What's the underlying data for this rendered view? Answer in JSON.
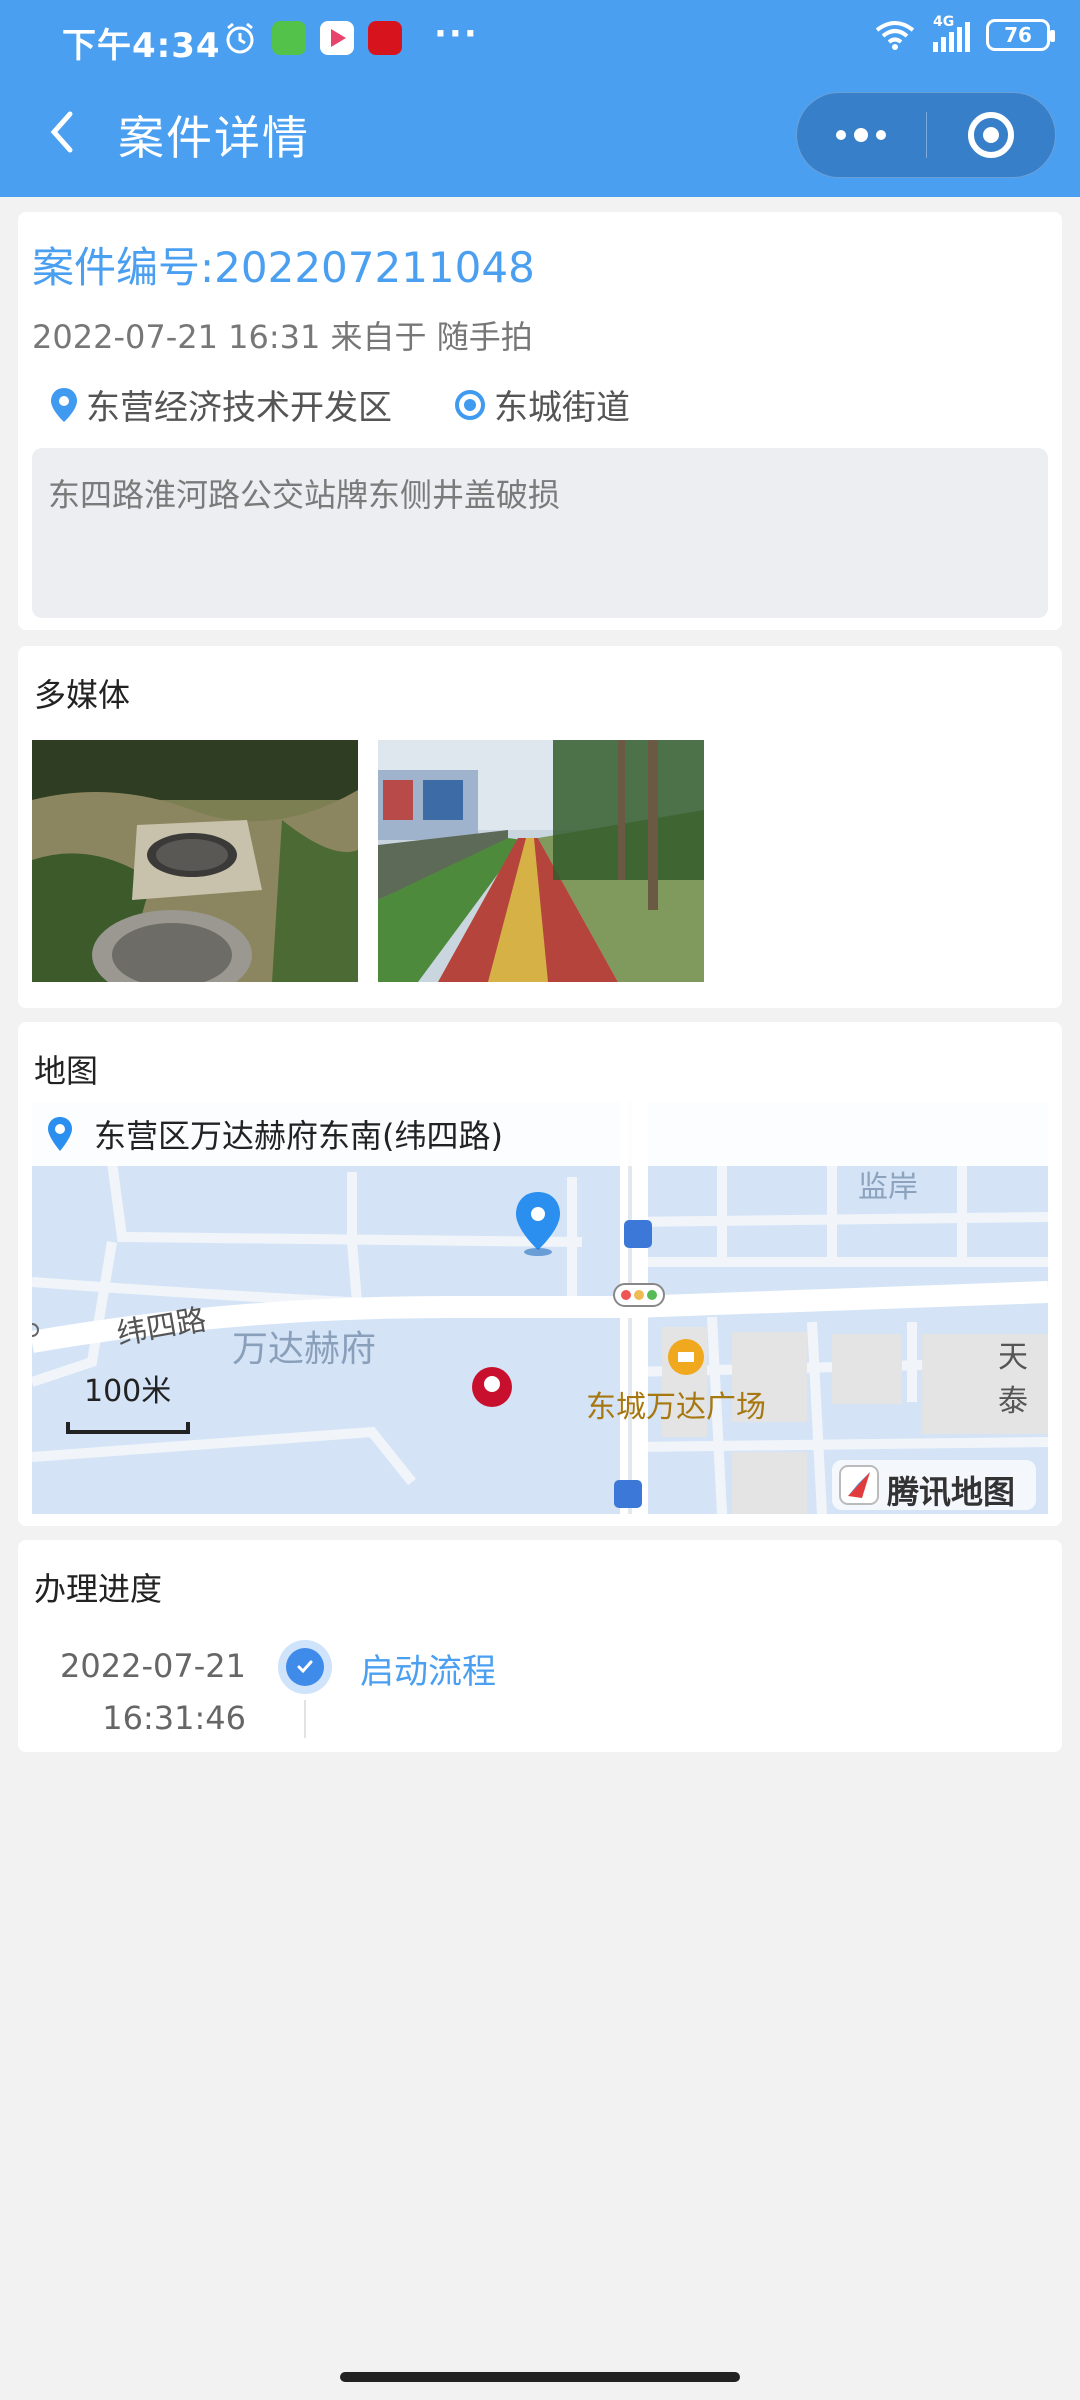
{
  "status_bar": {
    "time": "下午4:34",
    "dots": "···",
    "network": "4G",
    "battery": "76"
  },
  "nav": {
    "title": "案件详情"
  },
  "case": {
    "number_label": "案件编号:202207211048",
    "meta": "2022-07-21 16:31 来自于 随手拍",
    "district": "东营经济技术开发区",
    "street": "东城街道",
    "description": "东四路淮河路公交站牌东侧井盖破损"
  },
  "media": {
    "title": "多媒体"
  },
  "map": {
    "title": "地图",
    "address": "东营区万达赫府东南(纬四路)",
    "labels": {
      "jianan": "监岸",
      "road": "纬四路",
      "wanda_hefu": "万达赫府",
      "plaza": "东城万达广场",
      "tian": "天泰",
      "scale": "100米",
      "brand": "腾讯地图"
    }
  },
  "progress": {
    "title": "办理进度",
    "date": "2022-07-21",
    "time": "16:31:46",
    "step": "启动流程"
  },
  "colors": {
    "header": "#4a9ff0",
    "accent": "#4a9ff0",
    "background": "#f2f2f2"
  }
}
